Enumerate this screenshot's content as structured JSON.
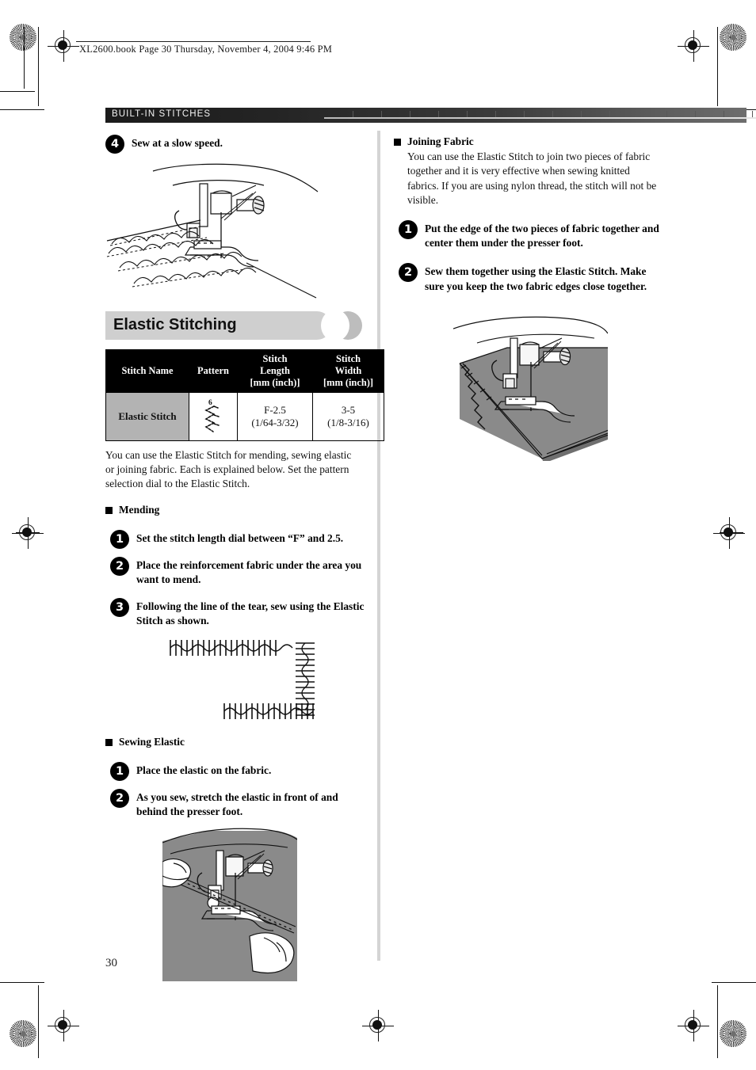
{
  "print_header": {
    "text": "XL2600.book  Page 30  Thursday, November 4, 2004  9:46 PM"
  },
  "running_head": {
    "label": "BUILT-IN STITCHES"
  },
  "page_number": "30",
  "left_column": {
    "step4": {
      "number": "4",
      "text": "Sew at a slow speed."
    },
    "illustration_top_name": "sewing-machine-presser-foot-shell-tuck",
    "section_title": "Elastic Stitching",
    "table": {
      "headers": [
        "Stitch Name",
        "Pattern",
        "Stitch\nLength\n[mm (inch)]",
        "Stitch\nWidth\n[mm (inch)]"
      ],
      "header_stitch_name": "Stitch Name",
      "header_pattern": "Pattern",
      "header_length_l1": "Stitch",
      "header_length_l2": "Length",
      "header_length_l3": "[mm (inch)]",
      "header_width_l1": "Stitch",
      "header_width_l2": "Width",
      "header_width_l3": "[mm (inch)]",
      "rows": [
        {
          "name": "Elastic Stitch",
          "pattern_number": "6",
          "pattern_icon": "elastic-zigzag-stitch-icon",
          "length_mm": "F-2.5",
          "length_inch": "(1/64-3/32)",
          "width_mm": "3-5",
          "width_inch": "(1/8-3/16)"
        }
      ]
    },
    "intro_paragraph": "You can use the Elastic Stitch for mending, sewing elastic or joining fabric. Each is explained below. Set the pattern selection dial to the Elastic Stitch.",
    "mending": {
      "heading": "Mending",
      "steps": [
        {
          "number": "1",
          "text": "Set the stitch length dial between “F” and 2.5."
        },
        {
          "number": "2",
          "text": "Place the reinforcement fabric under the area you want to mend."
        },
        {
          "number": "3",
          "text": "Following the line of the tear, sew using the Elastic Stitch as shown."
        }
      ],
      "illustration_name": "mending-stitch-rows-diagram"
    },
    "sewing_elastic": {
      "heading": "Sewing Elastic",
      "steps": [
        {
          "number": "1",
          "text": "Place the elastic on the fabric."
        },
        {
          "number": "2",
          "text": "As you sew, stretch the elastic in front of and behind the presser foot."
        }
      ],
      "illustration_name": "stretching-elastic-under-presser-foot"
    }
  },
  "right_column": {
    "joining_fabric": {
      "heading": "Joining Fabric",
      "paragraph": "You can use the Elastic Stitch to join two pieces of fabric together and it is very effective when sewing knitted fabrics. If you are using nylon thread, the stitch will not be visible.",
      "steps": [
        {
          "number": "1",
          "text": "Put the edge of the two pieces of fabric together and center them under the presser foot."
        },
        {
          "number": "2",
          "text": "Sew them together using the Elastic Stitch. Make sure you keep the two fabric edges close together."
        }
      ],
      "illustration_name": "joining-two-fabric-pieces-presser-foot"
    }
  },
  "colors": {
    "header_bar_dark": "#1b1b1b",
    "table_header_bg": "#000000",
    "name_cell_bg": "#b3b3b3",
    "section_title_bg": "#cfcfcf",
    "fabric_gray": "#808080",
    "divider": "#d4d4d4"
  }
}
